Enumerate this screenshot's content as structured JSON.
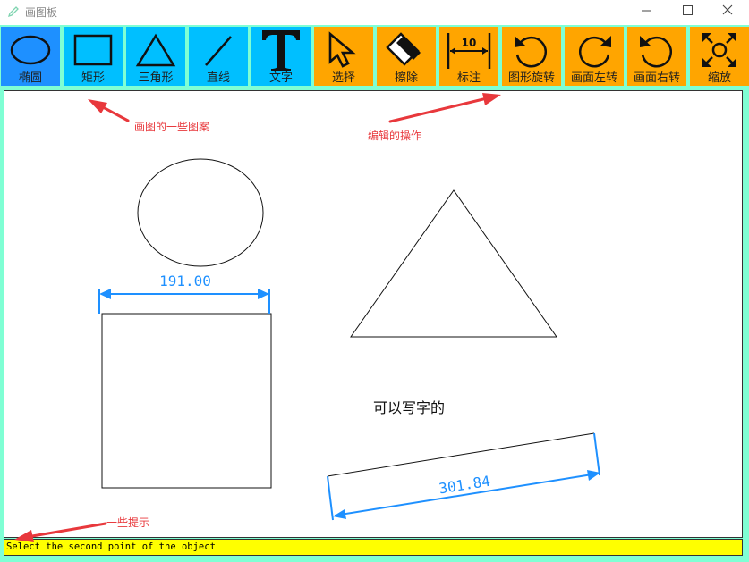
{
  "window": {
    "title": "画图板",
    "controls": [
      "minimize",
      "maximize",
      "close"
    ]
  },
  "toolbar": {
    "tools": [
      {
        "id": "ellipse",
        "label": "椭圆",
        "icon": "ellipse-icon",
        "group": "draw",
        "active": true
      },
      {
        "id": "rectangle",
        "label": "矩形",
        "icon": "rectangle-icon",
        "group": "draw",
        "active": false
      },
      {
        "id": "triangle",
        "label": "三角形",
        "icon": "triangle-icon",
        "group": "draw",
        "active": false
      },
      {
        "id": "line",
        "label": "直线",
        "icon": "line-icon",
        "group": "draw",
        "active": false
      },
      {
        "id": "text",
        "label": "文字",
        "icon": "text-icon",
        "group": "draw",
        "active": false
      },
      {
        "id": "select",
        "label": "选择",
        "icon": "cursor-arrow-icon",
        "group": "edit",
        "active": false
      },
      {
        "id": "erase",
        "label": "擦除",
        "icon": "eraser-icon",
        "group": "edit",
        "active": false
      },
      {
        "id": "dimension",
        "label": "标注",
        "icon": "dimension-icon",
        "group": "edit",
        "active": false,
        "icon_text": "10"
      },
      {
        "id": "rotate-shape",
        "label": "图形旋转",
        "icon": "rotate-ccw-icon",
        "group": "edit",
        "active": false
      },
      {
        "id": "rotate-view-left",
        "label": "画面左转",
        "icon": "rotate-cw-icon",
        "group": "edit",
        "active": false
      },
      {
        "id": "rotate-view-right",
        "label": "画面右转",
        "icon": "rotate-ccw-icon",
        "group": "edit",
        "active": false
      },
      {
        "id": "zoom",
        "label": "缩放",
        "icon": "zoom-arrows-icon",
        "group": "edit",
        "active": false
      }
    ]
  },
  "canvas": {
    "text_object": "可以写字的",
    "dimension_horizontal": "191.00",
    "dimension_rotated": "301.84"
  },
  "annotations": {
    "drawing_tools": "画图的一些图案",
    "editing_tools": "编辑的操作",
    "hints": "一些提示"
  },
  "status": {
    "message": "Select the second point of the object"
  },
  "colors": {
    "frame": "#7fffd4",
    "draw_tool_bg": "#00bfff",
    "active_tool_bg": "#1e90ff",
    "edit_tool_bg": "#ffa500",
    "status_bg": "#ffff00",
    "dimension": "#1e90ff",
    "annotation": "#e8383c"
  }
}
